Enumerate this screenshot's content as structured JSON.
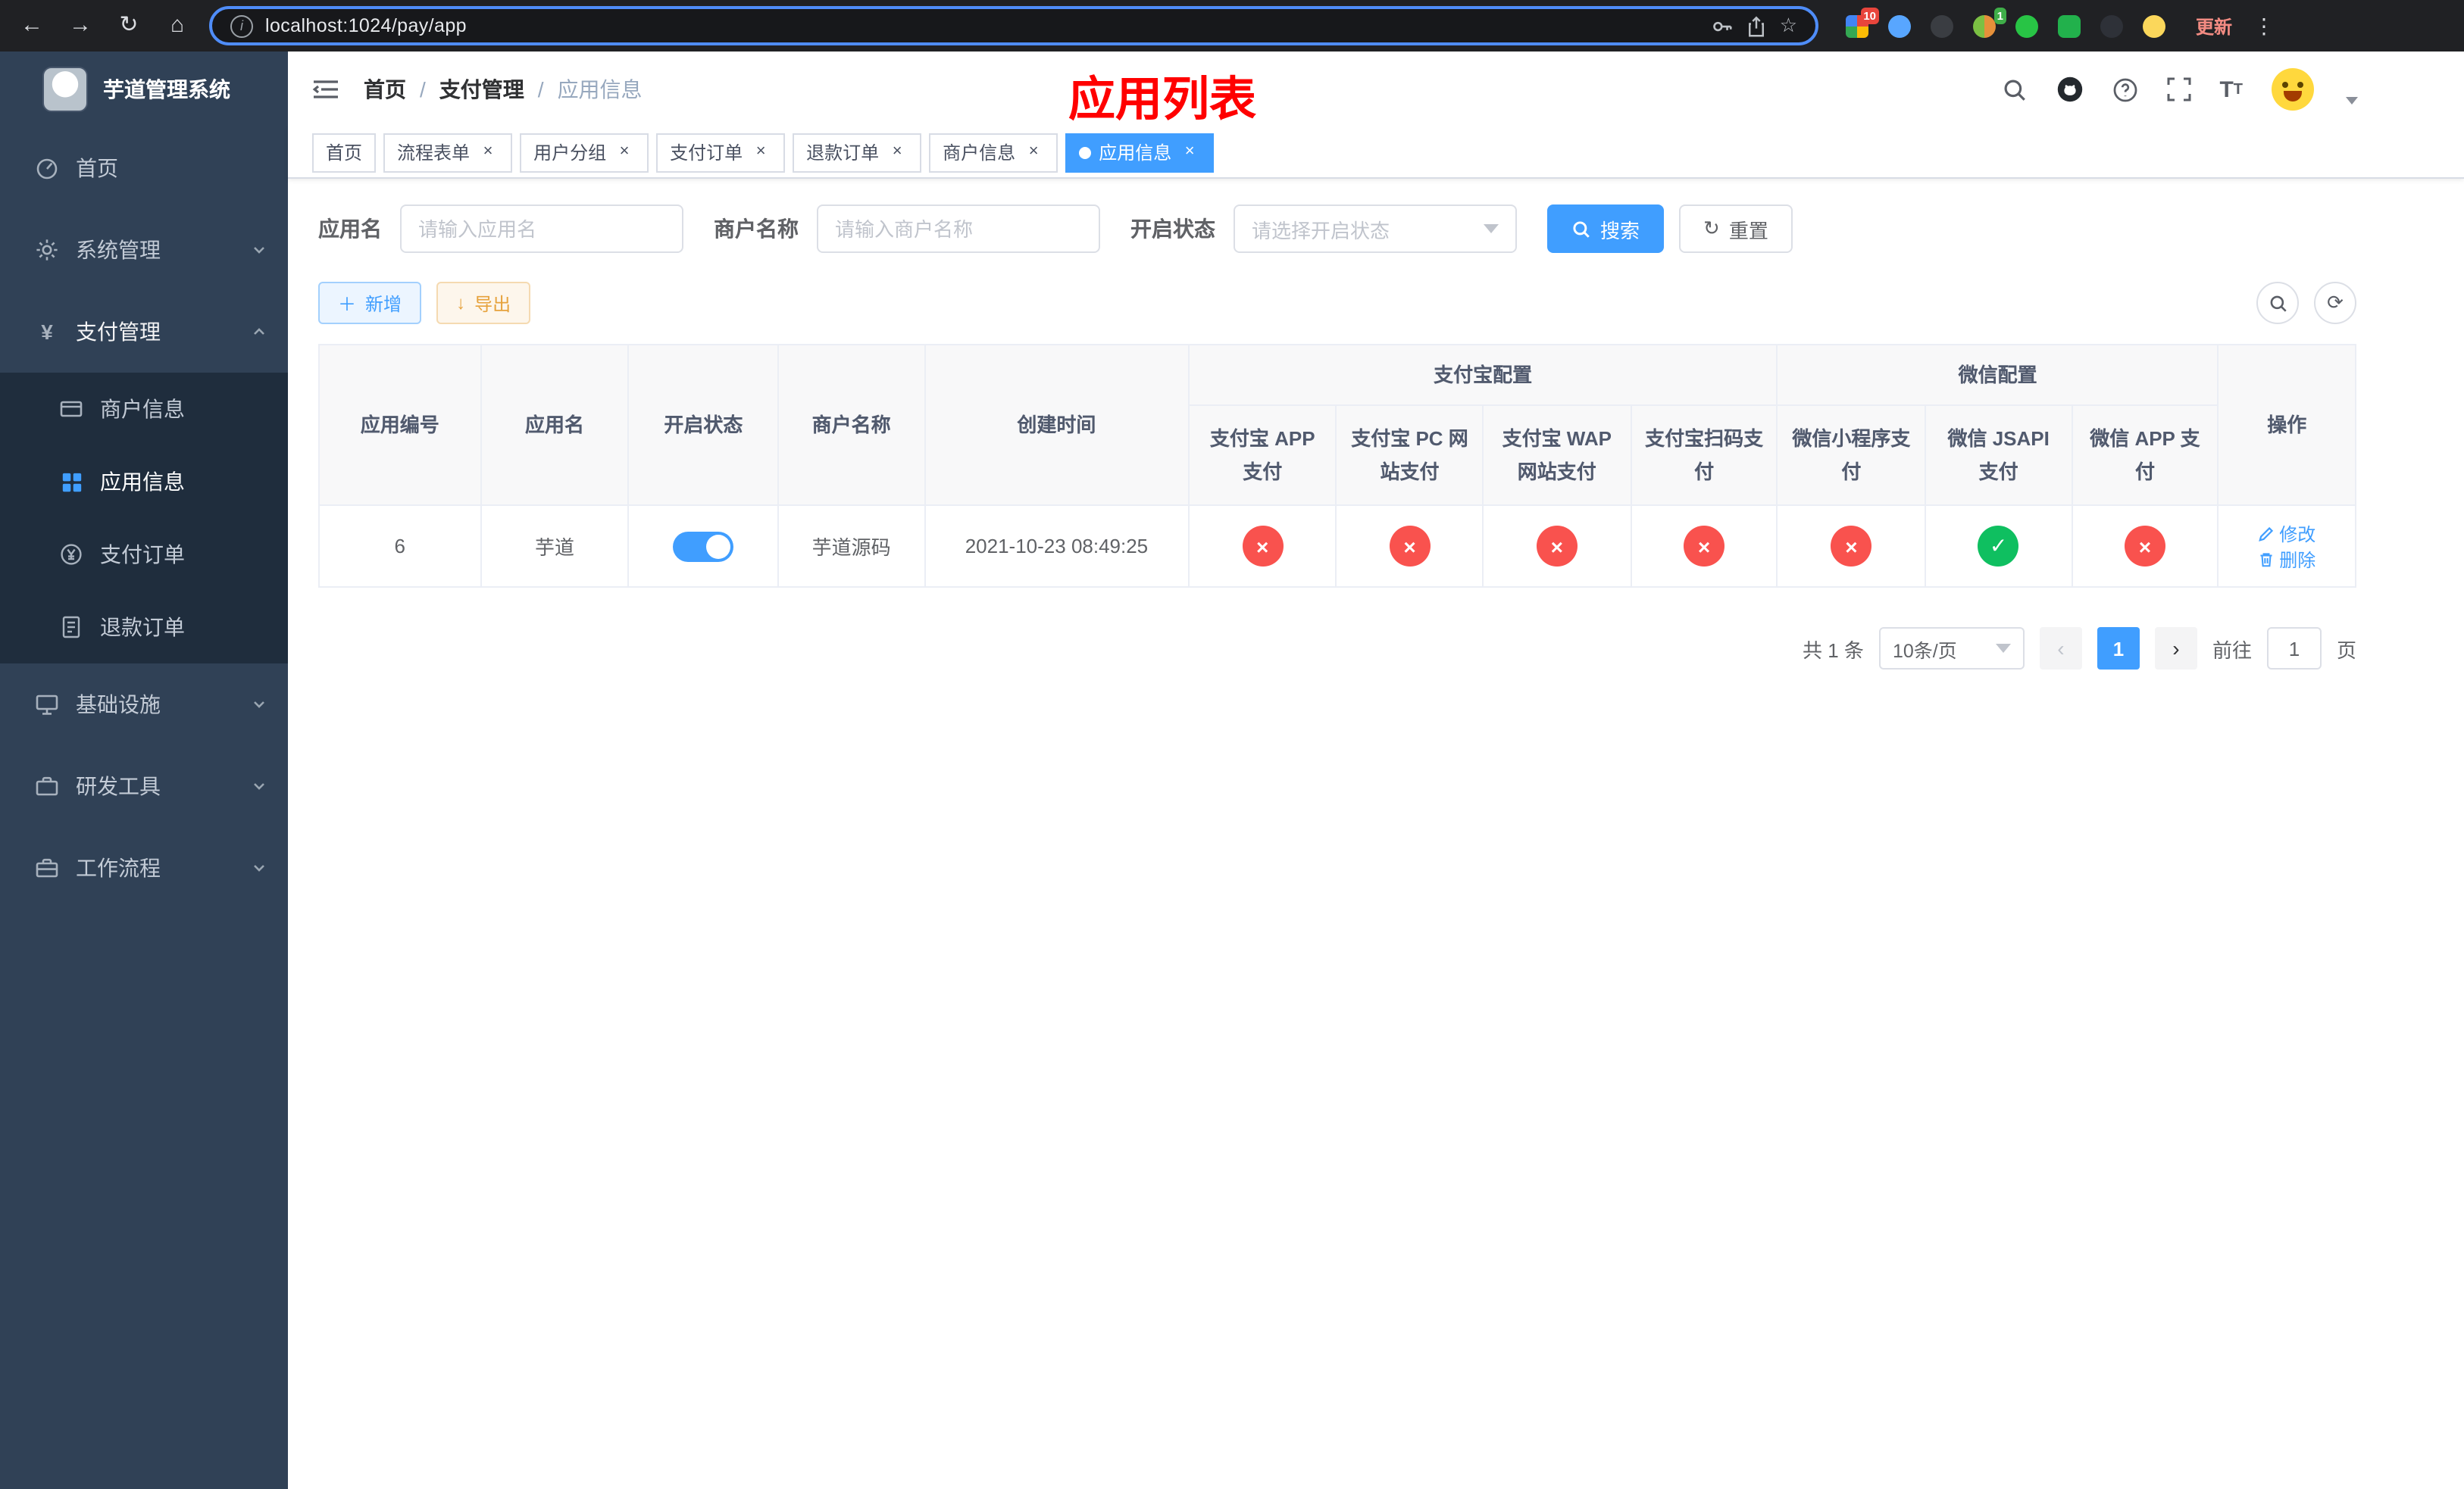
{
  "theme": {
    "primary": "#409eff",
    "success": "#0fbf60",
    "danger": "#f9524e",
    "warning": "#e6a23c",
    "sidebar_bg": "#304156",
    "submenu_bg": "#1f2d3d",
    "annotation": "#ff0000",
    "chrome_bg": "#202124"
  },
  "icons": {
    "check": "✓",
    "cross": "×"
  },
  "browser": {
    "url": "localhost:1024/pay/app",
    "update": "更新",
    "badge_a": "10",
    "badge_b": "1"
  },
  "sidebar": {
    "title": "芋道管理系统",
    "items": [
      "首页",
      "系统管理",
      "支付管理",
      "基础设施",
      "研发工具",
      "工作流程"
    ],
    "payment_children": [
      "商户信息",
      "应用信息",
      "支付订单",
      "退款订单"
    ]
  },
  "header": {
    "breadcrumb": [
      "首页",
      "支付管理",
      "应用信息"
    ],
    "separator": "/",
    "annotation": "应用列表"
  },
  "tabs": [
    {
      "label": "首页"
    },
    {
      "label": "流程表单"
    },
    {
      "label": "用户分组"
    },
    {
      "label": "支付订单"
    },
    {
      "label": "退款订单"
    },
    {
      "label": "商户信息"
    },
    {
      "label": "应用信息"
    }
  ],
  "filters": {
    "app_name": {
      "label": "应用名",
      "placeholder": "请输入应用名"
    },
    "merchant_name": {
      "label": "商户名称",
      "placeholder": "请输入商户名称"
    },
    "status": {
      "label": "开启状态",
      "placeholder": "请选择开启状态"
    },
    "search": "搜索",
    "reset": "重置"
  },
  "toolbar": {
    "add": "新增",
    "export": "导出"
  },
  "table": {
    "columns": {
      "app_id": "应用编号",
      "app_name": "应用名",
      "status": "开启状态",
      "merchant": "商户名称",
      "created": "创建时间",
      "alipay_group": "支付宝配置",
      "wechat_group": "微信配置",
      "alipay": [
        "支付宝 APP 支付",
        "支付宝 PC 网站支付",
        "支付宝 WAP 网站支付",
        "支付宝扫码支付"
      ],
      "wechat": [
        "微信小程序支付",
        "微信 JSAPI 支付",
        "微信 APP 支付"
      ],
      "ops": "操作"
    },
    "rows": [
      {
        "app_id": "6",
        "app_name": "芋道",
        "status_on": true,
        "merchant": "芋道源码",
        "created": "2021-10-23 08:49:25",
        "alipay": [
          "cross",
          "cross",
          "cross",
          "cross"
        ],
        "wechat": [
          "cross",
          "check",
          "cross"
        ],
        "edit": "修改",
        "delete": "删除"
      }
    ]
  },
  "pagination": {
    "total": "共 1 条",
    "page_size": "10条/页",
    "page": "1",
    "goto": "前往",
    "goto_value": "1",
    "page_unit": "页"
  }
}
